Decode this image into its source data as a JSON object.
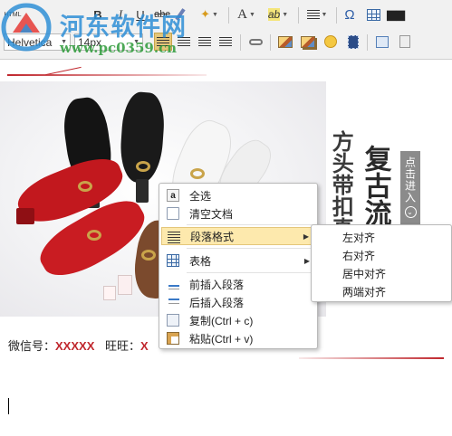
{
  "toolbar": {
    "row1_labels": {
      "html": "HTML",
      "bold": "B",
      "italic": "I",
      "underline": "U",
      "strike": "abc",
      "font_color": "A",
      "highlight": "ab",
      "special_char": "Ω"
    },
    "font_family": "Helvetica",
    "font_size": "14px"
  },
  "watermark": {
    "title": "河东软件网",
    "url": "www.pc0359.cn"
  },
  "banner": {
    "headline_1": "复古流",
    "headline_2": "方头带扣真",
    "cta": "点击进入",
    "cta_arrow": "⌄"
  },
  "contact": {
    "wechat_label": "微信号：",
    "wechat_value": "XXXXX",
    "wangwang_label": "旺旺：",
    "wangwang_value": "X"
  },
  "context_menu": {
    "items": [
      {
        "label": "全选",
        "icon": "select-all-icon"
      },
      {
        "label": "清空文档",
        "icon": "clear-document-icon"
      },
      {
        "label": "段落格式",
        "icon": "paragraph-format-icon",
        "has_submenu": true,
        "highlighted": true
      },
      {
        "label": "表格",
        "icon": "table-icon",
        "has_submenu": true
      },
      {
        "label": "前插入段落",
        "icon": "insert-paragraph-before-icon"
      },
      {
        "label": "后插入段落",
        "icon": "insert-paragraph-after-icon"
      },
      {
        "label": "复制(Ctrl + c)",
        "icon": "copy-icon"
      },
      {
        "label": "粘贴(Ctrl + v)",
        "icon": "paste-icon"
      }
    ],
    "submenu_arrow": "▶"
  },
  "submenu": {
    "items": [
      "左对齐",
      "右对齐",
      "居中对齐",
      "两端对齐"
    ]
  },
  "colors": {
    "accent_red": "#c0272d",
    "menu_highlight": "#fde9ad",
    "watermark_blue": "#2f8fd6",
    "watermark_green": "#2e9b3a"
  }
}
